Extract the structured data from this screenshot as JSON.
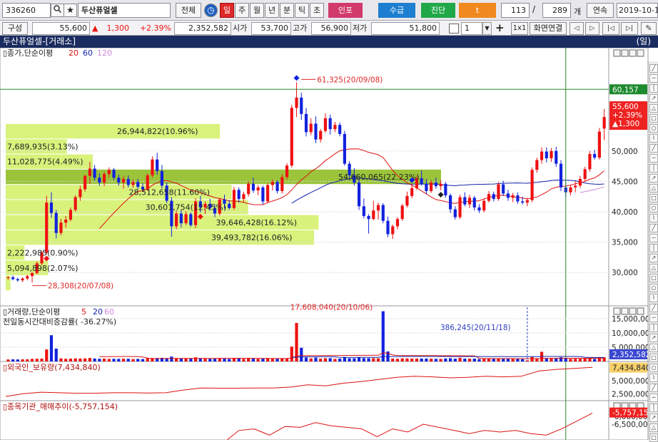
{
  "toolbar": {
    "code": "336260",
    "name": "두산퓨얼셀",
    "all_btn": "전체",
    "period_tabs": [
      "일",
      "주",
      "월",
      "년",
      "분",
      "틱",
      "초"
    ],
    "active_tab": "일",
    "btn_inpo": "인포",
    "btn_supply": "수급",
    "btn_diag": "진단",
    "btn_t": "t",
    "count1": "113",
    "count2": "289",
    "count_unit": "개",
    "continuous": "연속",
    "date": "2019-10-1"
  },
  "quote": {
    "layout_btn": "구성",
    "price": "55,600",
    "change_arrow": "▲",
    "change": "1,300",
    "change_pct": "+2.39%",
    "volume": "2,352,582",
    "open_label": "시가",
    "open": "53,700",
    "high_label": "고가",
    "high": "56,900",
    "low_label": "저가",
    "low": "51,800",
    "spin_value": "1",
    "ratio_btn": "1x1",
    "link_btn": "화면연결"
  },
  "title_bar": {
    "left": "두산퓨얼셀-[거래소]",
    "right": "(일)"
  },
  "colors": {
    "up": "#ee1111",
    "down": "#1122dd",
    "ma20": "#dd1111",
    "ma60": "#1122aa",
    "ma120": "#cc88dd",
    "vp": "#d8f27c",
    "vp_max": "#9bc43a",
    "vline": "#2a8a2a"
  },
  "icons": [
    "chart-type-icon",
    "step-prev-icon",
    "step-next-icon",
    "play-prev-icon",
    "play-next-icon",
    "pen-icon"
  ],
  "chart_data": {
    "type": "candlestick",
    "panels": {
      "price": {
        "label": "종가,단순이평",
        "ma_labels": [
          "20",
          "60",
          "120"
        ],
        "ylim": [
          24500,
          67000
        ],
        "yticks": [
          30000,
          35000,
          40000,
          45000,
          50000
        ],
        "ytick_labels": [
          "30,000",
          "35,000",
          "40,000",
          "45,000",
          "50,000"
        ],
        "current_price_label": [
          "55,600",
          "+2.39%",
          "▲1,300"
        ],
        "marker_level": 60157,
        "marker_level_label": "60,157",
        "annotations": [
          {
            "text": "61,325(20/09/08)",
            "index": 61,
            "value": 61325
          },
          {
            "text": "28,308(20/07/08)",
            "index": 5,
            "value": 28308
          }
        ],
        "volume_profile": [
          {
            "low": 27000,
            "high": 29500,
            "label": "",
            "len": 0.02
          },
          {
            "low": 29500,
            "high": 32000,
            "label": "5,094,898(2.07%)",
            "len": 0.18
          },
          {
            "low": 32000,
            "high": 34500,
            "label": "2,222,985(0.90%)",
            "len": 0.08
          },
          {
            "low": 34500,
            "high": 37000,
            "label": "39,493,782(16.06%)",
            "len": 1.31
          },
          {
            "low": 37000,
            "high": 39500,
            "label": "39,646,428(16.12%)",
            "len": 1.33
          },
          {
            "low": 39500,
            "high": 42000,
            "label": "30,601,754(12.45%)",
            "len": 1.03
          },
          {
            "low": 42000,
            "high": 44500,
            "label": "28,512,658(11.60%)",
            "len": 0.96
          },
          {
            "low": 44500,
            "high": 47000,
            "label": "54,660,065(22.23%)",
            "len": 1.85
          },
          {
            "low": 47000,
            "high": 49500,
            "label": "11,028,775(4.49%)",
            "len": 0.37
          },
          {
            "low": 49500,
            "high": 52000,
            "label": "7,689,935(3.13%)",
            "len": 0.26
          },
          {
            "low": 52000,
            "high": 54500,
            "label": "26,944,822(10.96%)",
            "len": 0.91
          }
        ],
        "candles": [
          [
            29100,
            29400,
            28800,
            29200
          ],
          [
            29200,
            29500,
            28700,
            28900
          ],
          [
            28900,
            29100,
            28500,
            28700
          ],
          [
            28700,
            29200,
            28400,
            29000
          ],
          [
            29000,
            29600,
            28700,
            29400
          ],
          [
            29400,
            30100,
            28308,
            29900
          ],
          [
            29900,
            31800,
            29700,
            31500
          ],
          [
            31500,
            33500,
            31200,
            33300
          ],
          [
            33300,
            42600,
            33000,
            41500
          ],
          [
            41500,
            43200,
            39000,
            39800
          ],
          [
            39800,
            40300,
            35600,
            36500
          ],
          [
            36500,
            38800,
            36100,
            38200
          ],
          [
            38200,
            39300,
            37400,
            38700
          ],
          [
            38700,
            40700,
            38400,
            40300
          ],
          [
            40300,
            42700,
            40000,
            42400
          ],
          [
            42400,
            44300,
            41800,
            43700
          ],
          [
            43700,
            46100,
            43300,
            45900
          ],
          [
            45900,
            48200,
            44600,
            47100
          ],
          [
            47100,
            47700,
            45100,
            45600
          ],
          [
            45600,
            46300,
            44300,
            44800
          ],
          [
            44800,
            46600,
            44200,
            46200
          ],
          [
            46200,
            47300,
            45600,
            46900
          ],
          [
            46900,
            47200,
            45200,
            45600
          ],
          [
            45600,
            46100,
            44300,
            44800
          ],
          [
            44800,
            45900,
            43800,
            45400
          ],
          [
            45400,
            46000,
            44000,
            44400
          ],
          [
            44400,
            45300,
            43900,
            44900
          ],
          [
            44900,
            45400,
            43700,
            44100
          ],
          [
            44100,
            44700,
            43300,
            43700
          ],
          [
            43700,
            46300,
            43400,
            46000
          ],
          [
            46000,
            49100,
            45600,
            48600
          ],
          [
            48600,
            49700,
            46100,
            46700
          ],
          [
            46700,
            47700,
            43800,
            44300
          ],
          [
            44300,
            44800,
            41400,
            41800
          ],
          [
            41800,
            42400,
            35900,
            37600
          ],
          [
            37600,
            40200,
            37100,
            39700
          ],
          [
            39700,
            40300,
            37400,
            38100
          ],
          [
            38100,
            40100,
            37800,
            39600
          ],
          [
            39600,
            39900,
            37500,
            37800
          ],
          [
            37800,
            42200,
            37300,
            41700
          ],
          [
            41700,
            42600,
            39900,
            40700
          ],
          [
            40700,
            41700,
            39600,
            41300
          ],
          [
            41300,
            42100,
            40200,
            40600
          ],
          [
            40600,
            41200,
            39100,
            39700
          ],
          [
            39700,
            42300,
            39400,
            42000
          ],
          [
            42000,
            42800,
            40500,
            41300
          ],
          [
            41300,
            41900,
            40300,
            40600
          ],
          [
            40600,
            44100,
            40300,
            43600
          ],
          [
            43600,
            44000,
            41500,
            42100
          ],
          [
            42100,
            43300,
            41600,
            42900
          ],
          [
            42900,
            45000,
            42500,
            44600
          ],
          [
            44600,
            45600,
            43100,
            43500
          ],
          [
            43500,
            44400,
            42700,
            44000
          ],
          [
            44000,
            44300,
            41200,
            41700
          ],
          [
            41700,
            44700,
            41400,
            44400
          ],
          [
            44400,
            45300,
            43500,
            44900
          ],
          [
            44900,
            45200,
            43000,
            43400
          ],
          [
            43400,
            46200,
            43000,
            45700
          ],
          [
            45700,
            48000,
            45300,
            47600
          ],
          [
            47600,
            57600,
            47300,
            57100
          ],
          [
            57100,
            61325,
            55600,
            58800
          ],
          [
            58800,
            59600,
            55100,
            56100
          ],
          [
            56100,
            57100,
            52400,
            53100
          ],
          [
            53100,
            55400,
            52600,
            54500
          ],
          [
            54500,
            55700,
            51300,
            51900
          ],
          [
            51900,
            53600,
            51400,
            53300
          ],
          [
            53300,
            56200,
            53000,
            55400
          ],
          [
            55400,
            56000,
            52700,
            53600
          ],
          [
            53600,
            54800,
            53100,
            54300
          ],
          [
            54300,
            54700,
            52400,
            52800
          ],
          [
            52800,
            53300,
            47600,
            47900
          ],
          [
            47900,
            48300,
            45300,
            46000
          ],
          [
            46000,
            47200,
            44300,
            44800
          ],
          [
            44800,
            45400,
            40300,
            40900
          ],
          [
            40900,
            42200,
            38900,
            39300
          ],
          [
            39300,
            39600,
            36400,
            38800
          ],
          [
            38800,
            41800,
            38600,
            40200
          ],
          [
            40200,
            41500,
            38700,
            41100
          ],
          [
            41100,
            41400,
            38100,
            38500
          ],
          [
            38500,
            39200,
            35800,
            36300
          ],
          [
            36300,
            37900,
            35500,
            37600
          ],
          [
            37600,
            39100,
            37100,
            38800
          ],
          [
            38800,
            41300,
            38500,
            41000
          ],
          [
            41000,
            43300,
            40700,
            42600
          ],
          [
            42600,
            44500,
            42200,
            43900
          ],
          [
            43900,
            45900,
            43600,
            45500
          ],
          [
            45500,
            46800,
            44300,
            44600
          ],
          [
            44600,
            45400,
            42900,
            43400
          ],
          [
            43400,
            45200,
            43100,
            44800
          ],
          [
            44800,
            45600,
            43800,
            44200
          ],
          [
            44200,
            45200,
            43500,
            44600
          ],
          [
            44600,
            44900,
            42300,
            42700
          ],
          [
            42700,
            43000,
            39800,
            40400
          ],
          [
            40400,
            40900,
            38700,
            39100
          ],
          [
            39100,
            42800,
            38800,
            42400
          ],
          [
            42400,
            43200,
            40900,
            41200
          ],
          [
            41200,
            42800,
            40600,
            42300
          ],
          [
            42300,
            42600,
            40200,
            40700
          ],
          [
            40700,
            41200,
            39800,
            40200
          ],
          [
            40200,
            42200,
            39900,
            41800
          ],
          [
            41800,
            43400,
            41500,
            42900
          ],
          [
            42900,
            43300,
            41700,
            42100
          ],
          [
            42100,
            44900,
            41800,
            44500
          ],
          [
            44500,
            45100,
            42600,
            43000
          ],
          [
            43000,
            43600,
            41800,
            42300
          ],
          [
            42300,
            43100,
            41600,
            42700
          ],
          [
            42700,
            43200,
            41300,
            41700
          ],
          [
            41700,
            42500,
            41200,
            41500
          ],
          [
            41500,
            42300,
            40900,
            41900
          ],
          [
            41900,
            47300,
            41600,
            46900
          ],
          [
            46900,
            48900,
            46400,
            48500
          ],
          [
            48500,
            50600,
            47900,
            49900
          ],
          [
            49900,
            50600,
            48100,
            48800
          ],
          [
            48800,
            50500,
            48200,
            50000
          ],
          [
            50000,
            50700,
            47400,
            47900
          ],
          [
            47900,
            48500,
            43400,
            44000
          ],
          [
            44000,
            44900,
            42400,
            43200
          ],
          [
            43200,
            44400,
            42700,
            44000
          ],
          [
            44000,
            45000,
            43200,
            44300
          ],
          [
            44300,
            45900,
            43900,
            45400
          ],
          [
            45400,
            47400,
            45000,
            47000
          ],
          [
            47000,
            50000,
            46600,
            49500
          ],
          [
            49500,
            50200,
            48600,
            48900
          ],
          [
            48900,
            53800,
            48600,
            53200
          ],
          [
            53700,
            56900,
            51800,
            55600
          ]
        ]
      },
      "volume": {
        "label": "거래량,단순이평",
        "ma_labels": [
          "5",
          "20",
          "60"
        ],
        "sub_label": "전일동시간대비증감률",
        "sub_value": "-36.27%",
        "ylim": [
          0,
          19500000
        ],
        "yticks": [
          5000000,
          10000000,
          15000000
        ],
        "ytick_labels": [
          "5,000,000",
          "10,000,000",
          "15,000,000"
        ],
        "current_label": "2,352,582",
        "annotations": [
          {
            "text": "17,608,040(20/10/06)",
            "index": 78,
            "value": 17608040
          },
          {
            "text": "386,245(20/11/18)",
            "index": 108,
            "value": 386245
          }
        ]
      },
      "foreign": {
        "label": "외국인_보유량",
        "value_label": "7,434,840",
        "ylim": [
          1200000,
          8600000
        ],
        "yticks": [
          2500000,
          5000000
        ],
        "ytick_labels": [
          "2,500,000",
          "5,000,000"
        ],
        "current_label": "7,434,840",
        "values": [
          2000000,
          2500000,
          2800000,
          2700000,
          2600000,
          2600000,
          2700000,
          2700000,
          2650000,
          2700000,
          3200000,
          3600000,
          3550000,
          3550000,
          3600000,
          3600000,
          3750000,
          4200000,
          4000000,
          4500000,
          4800000,
          5200000,
          5600000,
          5800000,
          5700000,
          5500000,
          5600000,
          5800000,
          5700000,
          5800000,
          6800000,
          7100000,
          7300000,
          7500000
        ]
      },
      "institution": {
        "label": "종목기관_매매추이",
        "value_label": "-5,757,154",
        "ylim": [
          -7500000,
          -5000000
        ],
        "yticks": [
          -6000000,
          -6500000
        ],
        "ytick_labels": [
          "-6,000,000",
          "-6,500,000"
        ],
        "current_label": "-5,757,154",
        "values": [
          -8200000,
          -8000000,
          -7700000,
          -6900000,
          -6800000,
          -7200000,
          -6650000,
          -6700000,
          -6400000,
          -6600000,
          -6700000,
          -6800000,
          -7300000,
          -6800000,
          -7000000,
          -6500000,
          -6700000,
          -6900000,
          -7100000,
          -6900000,
          -7000000,
          -6900000,
          -7100000,
          -7200000,
          -6800000,
          -6300000,
          -5800000
        ]
      }
    }
  }
}
